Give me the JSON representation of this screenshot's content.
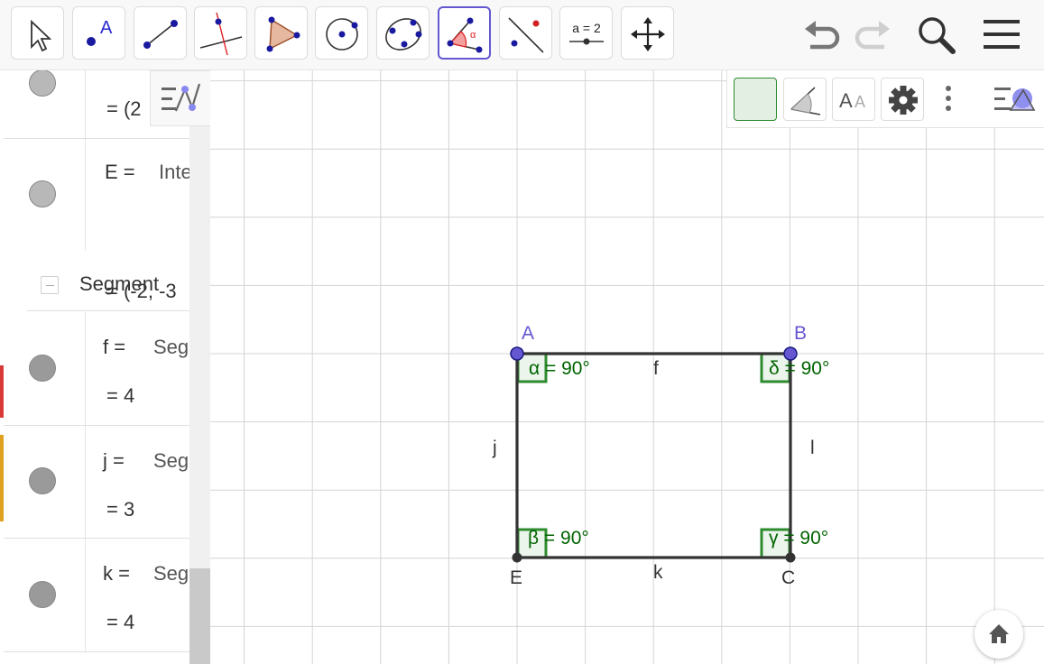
{
  "toolbar": {
    "tools": [
      {
        "name": "move-tool",
        "label": ""
      },
      {
        "name": "point-tool",
        "label": "A"
      },
      {
        "name": "segment-tool",
        "label": ""
      },
      {
        "name": "perpendicular-line-tool",
        "label": ""
      },
      {
        "name": "polygon-tool",
        "label": ""
      },
      {
        "name": "circle-center-point-tool",
        "label": ""
      },
      {
        "name": "conic-tool",
        "label": ""
      },
      {
        "name": "angle-tool",
        "label": "α"
      },
      {
        "name": "reflect-tool",
        "label": ""
      },
      {
        "name": "slider-tool",
        "label": "a = 2"
      },
      {
        "name": "move-graphics-view-tool",
        "label": ""
      }
    ],
    "active_tool": "angle-tool",
    "accent": "#6557d2"
  },
  "algebra": {
    "rows": [
      {
        "name": "row-d",
        "def": "",
        "value": "= (2"
      },
      {
        "name": "row-E",
        "def": "E = ",
        "cmd": "Inte",
        "value": "= (-2, -3"
      },
      {
        "name": "row-f",
        "def": "f = ",
        "cmd": "Segr",
        "value": "= 4"
      },
      {
        "name": "row-j",
        "def": "j = ",
        "cmd": "Segr",
        "value": "= 3"
      },
      {
        "name": "row-k",
        "def": "k = ",
        "cmd": "Seg",
        "value": "= 4"
      }
    ],
    "category": "Segment"
  },
  "graphics": {
    "points": [
      {
        "name": "A",
        "label": "A",
        "color": "#6557d2"
      },
      {
        "name": "B",
        "label": "B",
        "color": "#6557d2"
      },
      {
        "name": "C",
        "label": "C",
        "color": "#333333"
      },
      {
        "name": "E",
        "label": "E",
        "color": "#333333"
      }
    ],
    "segments": {
      "f": "f",
      "j": "j",
      "l": "l",
      "k": "k"
    },
    "angles": {
      "alpha": "α = 90°",
      "delta": "δ = 90°",
      "beta": "β = 90°",
      "gamma": "γ = 90°"
    },
    "angle_color": "#006400"
  },
  "style_bar": {
    "font_size_label": "AA"
  }
}
